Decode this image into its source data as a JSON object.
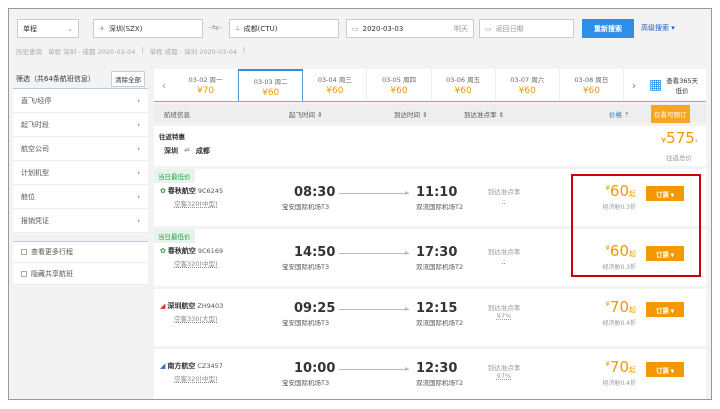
{
  "search": {
    "trip_type": "单程",
    "from": "深圳(SZX)",
    "to": "成都(CTU)",
    "date": "2020-03-03",
    "date_hint": "明天",
    "return_placeholder": "返回日期",
    "search_button": "重新搜索",
    "advanced": "高级搜索 ▾"
  },
  "history": {
    "label": "历史查询",
    "items": [
      "单程 深圳 - 成都 2020-03-04",
      "单程 成都 - 深圳 2020-03-04"
    ]
  },
  "filter": {
    "title": "筛选（共64条航班信息）",
    "clear": "清除全部",
    "items": [
      "直飞/经停",
      "起飞时段",
      "航空公司",
      "计划机型",
      "舱位",
      "报销凭证"
    ],
    "checks": [
      "查看更多行程",
      "隐藏共享航班"
    ]
  },
  "dates": [
    {
      "d": "03-02 周一",
      "p": "¥70"
    },
    {
      "d": "03-03 周二",
      "p": "¥60"
    },
    {
      "d": "03-04 周三",
      "p": "¥60"
    },
    {
      "d": "03-05 周四",
      "p": "¥60"
    },
    {
      "d": "03-06 周五",
      "p": "¥60"
    },
    {
      "d": "03-07 周六",
      "p": "¥60"
    },
    {
      "d": "03-08 周日",
      "p": "¥60"
    }
  ],
  "calendar": {
    "line1": "查看365天",
    "line2": "低价"
  },
  "columns": {
    "info": "航班信息",
    "dep": "起飞时间 ⇕",
    "arr": "到达时间 ⇕",
    "ontime": "到达准点率 ⇕",
    "price": "价格 ⇡",
    "special": "仅看可预订"
  },
  "roundtrip": {
    "title": "往返特惠",
    "from": "深圳",
    "to": "成都",
    "sep": "⇌",
    "price": "575",
    "currency": "¥",
    "label": "往返总价"
  },
  "flights": [
    {
      "tag": "当日最低价",
      "airline": "春秋航空",
      "no": "9C6245",
      "plane": "空客320(中型)",
      "dep": "08:30",
      "dep_ap": "宝安国际机场T3",
      "arr": "11:10",
      "arr_ap": "双流国际机场T2",
      "ontime_label": "到达准点率",
      "ontime": "-",
      "price": "60",
      "cls": "经济舱0.3折",
      "book": "订票 ▾",
      "color": "#2a9d4a",
      "icon": "✿"
    },
    {
      "tag": "当日最低价",
      "airline": "春秋航空",
      "no": "9C6169",
      "plane": "空客320(中型)",
      "dep": "14:50",
      "dep_ap": "宝安国际机场T3",
      "arr": "17:30",
      "arr_ap": "双流国际机场T2",
      "ontime_label": "到达准点率",
      "ontime": "-",
      "price": "60",
      "cls": "经济舱0.3折",
      "book": "订票 ▾",
      "color": "#2a9d4a",
      "icon": "✿"
    },
    {
      "airline": "深圳航空",
      "no": "ZH9403",
      "plane": "空客330(大型)",
      "dep": "09:25",
      "dep_ap": "宝安国际机场T3",
      "arr": "12:15",
      "arr_ap": "双流国际机场T2",
      "ontime_label": "到达准点率",
      "ontime": "97%",
      "price": "70",
      "cls": "经济舱0.4折",
      "book": "订票 ▾",
      "color": "#d9302c",
      "icon": "◢"
    },
    {
      "airline": "南方航空",
      "no": "CZ3457",
      "plane": "空客320(中型)",
      "dep": "10:00",
      "dep_ap": "宝安国际机场T3",
      "arr": "12:30",
      "arr_ap": "双流国际机场T2",
      "ontime_label": "到达准点率",
      "ontime": "97%",
      "price": "70",
      "cls": "经济舱0.4折",
      "book": "订票 ▾",
      "color": "#2f6db5",
      "icon": "◢"
    }
  ],
  "currency": "¥",
  "price_suffix": "起"
}
